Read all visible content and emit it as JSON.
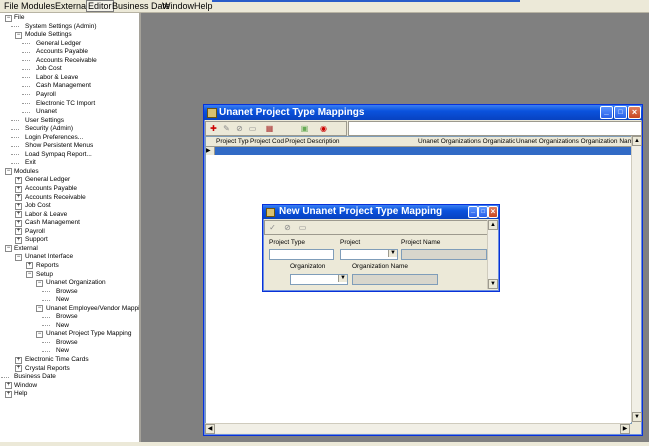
{
  "menubar": {
    "items": [
      "File",
      "Modules",
      "External",
      "Editor",
      "Business Date",
      "Window",
      "Help"
    ],
    "active": "Editor"
  },
  "tree": [
    {
      "label": "File",
      "level": 0,
      "toggle": "−"
    },
    {
      "label": "System Settings (Admin)",
      "level": 1
    },
    {
      "label": "Module Settings",
      "level": 1,
      "toggle": "−"
    },
    {
      "label": "General Ledger",
      "level": 2
    },
    {
      "label": "Accounts Payable",
      "level": 2
    },
    {
      "label": "Accounts Receivable",
      "level": 2
    },
    {
      "label": "Job Cost",
      "level": 2
    },
    {
      "label": "Labor & Leave",
      "level": 2
    },
    {
      "label": "Cash Management",
      "level": 2
    },
    {
      "label": "Payroll",
      "level": 2
    },
    {
      "label": "Electronic TC Import",
      "level": 2
    },
    {
      "label": "Unanet",
      "level": 2
    },
    {
      "label": "User Settings",
      "level": 1
    },
    {
      "label": "Security  (Admin)",
      "level": 1
    },
    {
      "label": "Login Preferences...",
      "level": 1
    },
    {
      "label": "Show Persistent Menus",
      "level": 1
    },
    {
      "label": "Load Sympaq Report...",
      "level": 1
    },
    {
      "label": "Exit",
      "level": 1
    },
    {
      "label": "Modules",
      "level": 0,
      "toggle": "−"
    },
    {
      "label": "General Ledger",
      "level": 1,
      "toggle": "+"
    },
    {
      "label": "Accounts Payable",
      "level": 1,
      "toggle": "+"
    },
    {
      "label": "Accounts Receivable",
      "level": 1,
      "toggle": "+"
    },
    {
      "label": "Job Cost",
      "level": 1,
      "toggle": "+"
    },
    {
      "label": "Labor & Leave",
      "level": 1,
      "toggle": "+"
    },
    {
      "label": "Cash Management",
      "level": 1,
      "toggle": "+"
    },
    {
      "label": "Payroll",
      "level": 1,
      "toggle": "+"
    },
    {
      "label": "Support",
      "level": 1,
      "toggle": "+"
    },
    {
      "label": "External",
      "level": 0,
      "toggle": "−"
    },
    {
      "label": "Unanet Interface",
      "level": 1,
      "toggle": "−"
    },
    {
      "label": "Reports",
      "level": 2,
      "toggle": "+"
    },
    {
      "label": "Setup",
      "level": 2,
      "toggle": "−"
    },
    {
      "label": "Unanet Organization",
      "level": 3,
      "toggle": "−"
    },
    {
      "label": "Browse",
      "level": 4
    },
    {
      "label": "New",
      "level": 4
    },
    {
      "label": "Unanet Employee/Vendor Mapping",
      "level": 3,
      "toggle": "−"
    },
    {
      "label": "Browse",
      "level": 4
    },
    {
      "label": "New",
      "level": 4
    },
    {
      "label": "Unanet Project Type Mapping",
      "level": 3,
      "toggle": "−"
    },
    {
      "label": "Browse",
      "level": 4
    },
    {
      "label": "New",
      "level": 4
    },
    {
      "label": "Electronic Time Cards",
      "level": 1,
      "toggle": "+"
    },
    {
      "label": "Crystal Reports",
      "level": 1,
      "toggle": "+"
    },
    {
      "label": "Business Date",
      "level": 0
    },
    {
      "label": "Window",
      "level": 0,
      "toggle": "+"
    },
    {
      "label": "Help",
      "level": 0,
      "toggle": "+"
    }
  ],
  "mapping_window": {
    "title": "Unanet Project Type Mappings",
    "columns": [
      "Project Type",
      "Project Code",
      "Project Description",
      "Unanet Organizations Organization ID",
      "Unanet Organizations Organization Name"
    ]
  },
  "new_window": {
    "title": "New Unanet Project Type Mapping",
    "labels": {
      "project_type": "Project Type",
      "project": "Project",
      "project_name": "Project Name",
      "organization": "Organizaton",
      "organization_name": "Organization Name"
    }
  }
}
